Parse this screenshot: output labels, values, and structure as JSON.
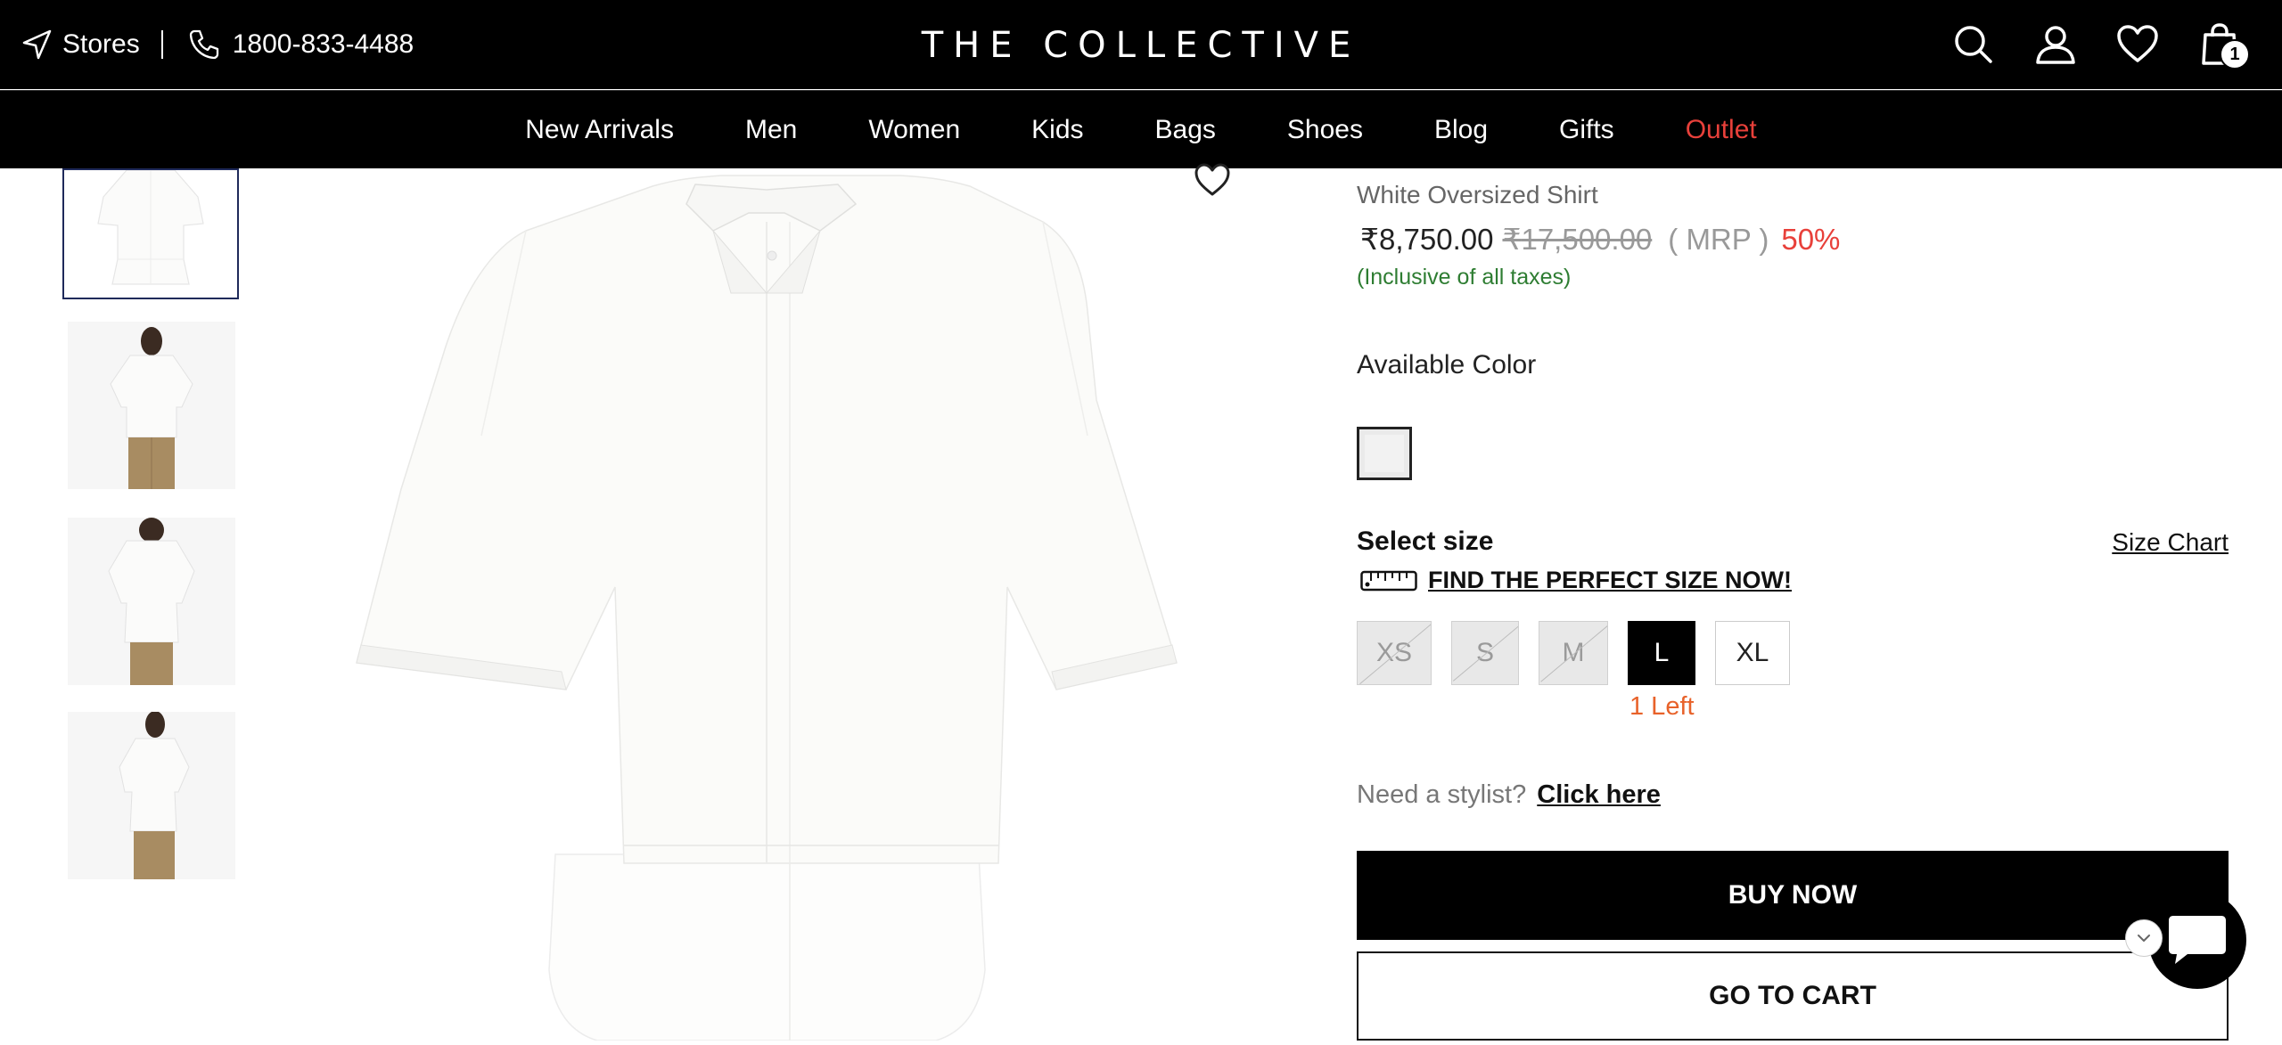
{
  "header": {
    "stores_label": "Stores",
    "phone": "1800-833-4488",
    "logo": "THE COLLECTIVE",
    "cart_count": "1",
    "icons": [
      "location-arrow-icon",
      "phone-icon",
      "search-icon",
      "user-icon",
      "heart-icon",
      "shopping-bag-icon"
    ]
  },
  "nav": {
    "items": [
      "New Arrivals",
      "Men",
      "Women",
      "Kids",
      "Bags",
      "Shoes",
      "Blog",
      "Gifts",
      "Outlet"
    ],
    "outlet_color": "#e8403a"
  },
  "product": {
    "name": "White Oversized Shirt",
    "price_symbol": "₹",
    "price": "8,750.00",
    "mrp_price": "17,500.00",
    "mrp_label": "( MRP )",
    "discount": "50%",
    "tax_note": "(Inclusive of all taxes)",
    "available_color_label": "Available Color",
    "select_size_label": "Select size",
    "size_chart_label": "Size Chart",
    "find_size_label": "FIND THE PERFECT SIZE NOW!",
    "sizes": [
      {
        "label": "XS",
        "state": "out-of-stock"
      },
      {
        "label": "S",
        "state": "out-of-stock"
      },
      {
        "label": "M",
        "state": "out-of-stock"
      },
      {
        "label": "L",
        "state": "selected"
      },
      {
        "label": "XL",
        "state": "available"
      }
    ],
    "stock_note": "1 Left",
    "stylist_prompt": "Need a stylist?",
    "stylist_link": "Click here",
    "buy_now_label": "BUY NOW",
    "go_to_cart_label": "GO TO CART"
  },
  "colors": {
    "accent_red": "#e8403a",
    "tax_green": "#2e7d32",
    "stock_orange": "#e8622a"
  }
}
